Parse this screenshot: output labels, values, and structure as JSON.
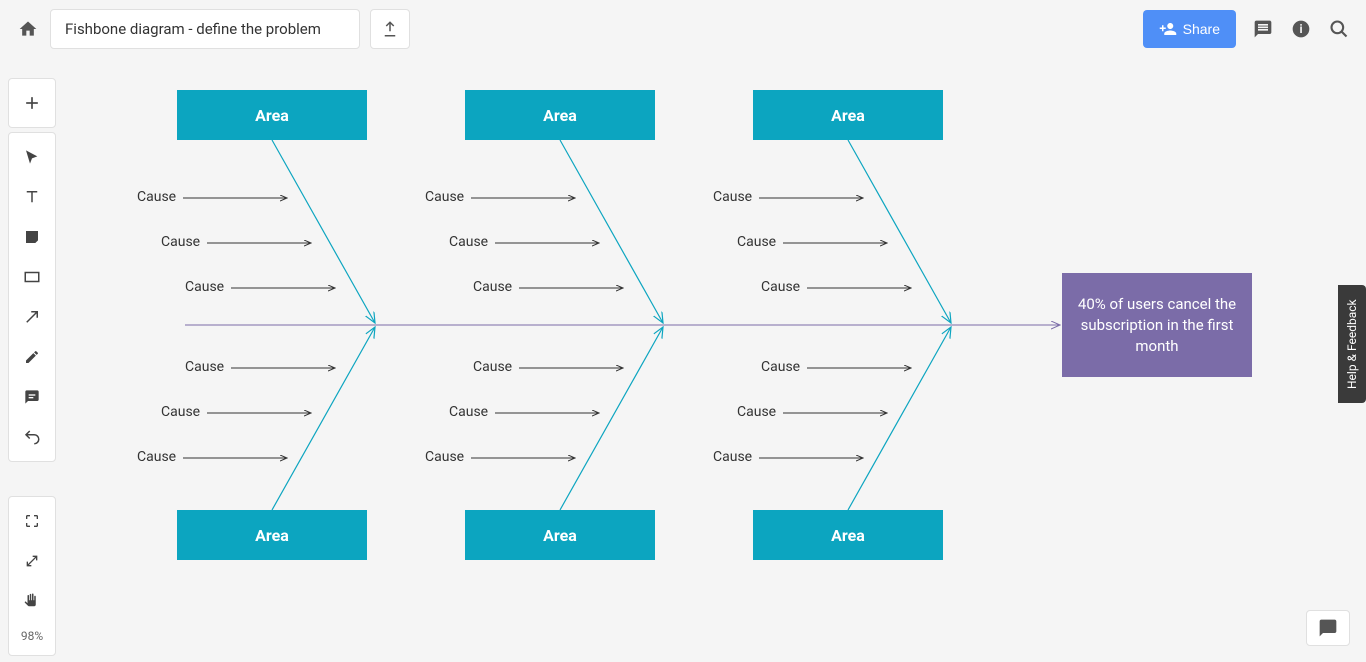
{
  "header": {
    "title": "Fishbone diagram - define the problem",
    "share_label": "Share"
  },
  "toolbar": {
    "zoom_level": "98%"
  },
  "help": {
    "label": "Help & Feedback"
  },
  "diagram": {
    "area_label": "Area",
    "cause_label": "Cause",
    "problem_text": "40% of users cancel the subscription in the first month"
  },
  "icons": {
    "home": "home-icon",
    "export": "export-icon",
    "share": "person-add-icon",
    "comment": "comment-icon",
    "info": "info-icon",
    "search": "search-icon",
    "add": "plus-icon",
    "cursor": "cursor-icon",
    "text": "text-icon",
    "note": "note-icon",
    "rect": "rectangle-icon",
    "arrow": "arrow-icon",
    "pencil": "pencil-icon",
    "comment2": "comment-tool-icon",
    "undo": "undo-icon",
    "expand": "expand-icon",
    "fit": "fit-icon",
    "hand": "hand-icon",
    "chat": "chat-icon"
  }
}
